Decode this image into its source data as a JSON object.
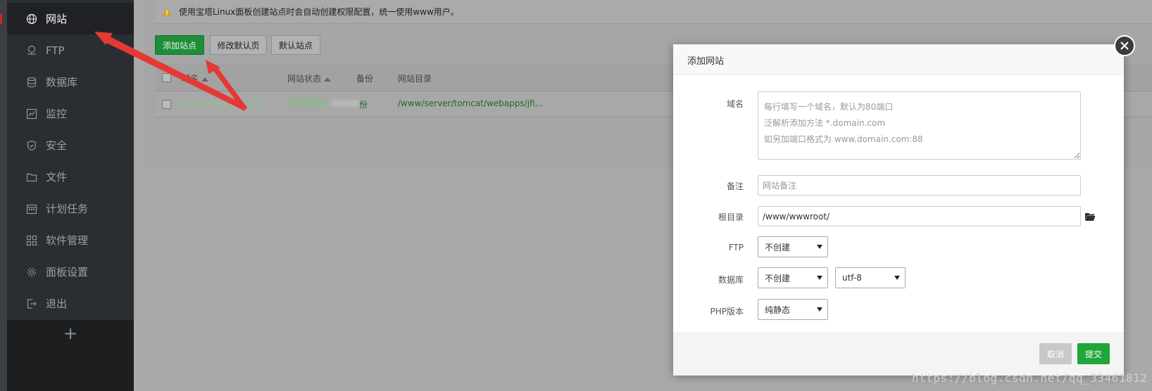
{
  "sidebar": {
    "items": [
      {
        "label": "网站",
        "icon": "globe-icon",
        "active": true
      },
      {
        "label": "FTP",
        "icon": "ftp-icon"
      },
      {
        "label": "数据库",
        "icon": "database-icon"
      },
      {
        "label": "监控",
        "icon": "monitor-icon"
      },
      {
        "label": "安全",
        "icon": "shield-icon"
      },
      {
        "label": "文件",
        "icon": "folder-icon"
      },
      {
        "label": "计划任务",
        "icon": "calendar-icon"
      },
      {
        "label": "软件管理",
        "icon": "grid-icon"
      },
      {
        "label": "面板设置",
        "icon": "gear-icon"
      },
      {
        "label": "退出",
        "icon": "logout-icon"
      }
    ],
    "add_label": "+"
  },
  "notice": {
    "text": "使用宝塔Linux面板创建站点时会自动创建权限配置，统一使用www用户。",
    "icon": "warning-icon"
  },
  "toolbar": {
    "add_site": "添加站点",
    "edit_default_page": "修改默认页",
    "default_site": "默认站点"
  },
  "table": {
    "headers": {
      "domain": "域名",
      "status": "网站状态",
      "backup": "备份",
      "root": "网站目录"
    },
    "rows": [
      {
        "backup": "份",
        "root": "/www/server/tomcat/webapps/jfi..."
      }
    ]
  },
  "modal": {
    "title": "添加网站",
    "domain_label": "域名",
    "domain_placeholder": "每行填写一个域名，默认为80端口\n泛解析添加方法 *.domain.com\n如另加端口格式为 www.domain.com:88",
    "remark_label": "备注",
    "remark_placeholder": "网站备注",
    "root_label": "根目录",
    "root_value": "/www/wwwroot/",
    "ftp_label": "FTP",
    "ftp_value": "不创建",
    "db_label": "数据库",
    "db_value": "不创建",
    "charset_value": "utf-8",
    "php_label": "PHP版本",
    "php_value": "纯静态",
    "cancel": "取消",
    "submit": "提交"
  },
  "watermark": "https://blog.csdn.net/qq_33461812",
  "colors": {
    "accent_green": "#20a53a",
    "arrow_red": "#e53935",
    "sidebar_bg": "#2a2d31"
  }
}
